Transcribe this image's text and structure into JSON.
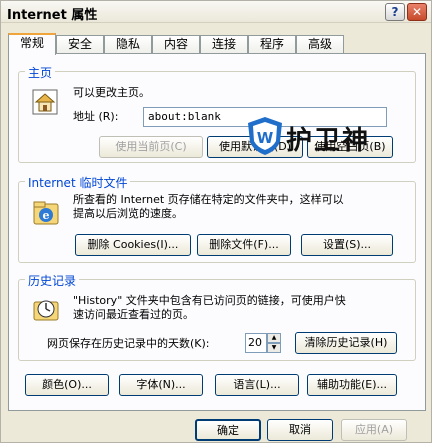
{
  "window": {
    "title": "Internet 属性",
    "help_label": "?",
    "close_label": "✕"
  },
  "tabs": [
    {
      "label": "常规"
    },
    {
      "label": "安全"
    },
    {
      "label": "隐私"
    },
    {
      "label": "内容"
    },
    {
      "label": "连接"
    },
    {
      "label": "程序"
    },
    {
      "label": "高级"
    }
  ],
  "homepage": {
    "group_label": "主页",
    "description": "可以更改主页。",
    "address_label": "地址 (R):",
    "address_value": "about:blank",
    "use_current": "使用当前页(C)",
    "use_default": "使用默认页(D)",
    "use_blank": "使用空白页(B)"
  },
  "watermark": {
    "text": "护卫神"
  },
  "temp_files": {
    "group_label": "Internet 临时文件",
    "description_line1": "所查看的 Internet 页存储在特定的文件夹中，这样可以",
    "description_line2": "提高以后浏览的速度。",
    "delete_cookies": "删除 Cookies(I)...",
    "delete_files": "删除文件(F)...",
    "settings": "设置(S)..."
  },
  "history": {
    "group_label": "历史记录",
    "description_line1": "\"History\" 文件夹中包含有已访问页的链接，可使用户快",
    "description_line2": "速访问最近查看过的页。",
    "days_label": "网页保存在历史记录中的天数(K):",
    "days_value": "20",
    "clear_history": "清除历史记录(H)"
  },
  "bottom_buttons": {
    "colors": "颜色(O)...",
    "fonts": "字体(N)...",
    "languages": "语言(L)...",
    "accessibility": "辅助功能(E)..."
  },
  "dialog_buttons": {
    "ok": "确定",
    "cancel": "取消",
    "apply": "应用(A)"
  },
  "colors": {
    "group_label": "#0046d5",
    "active_tab_accent": "#f0a53c",
    "close_button": "#c64a2b"
  }
}
